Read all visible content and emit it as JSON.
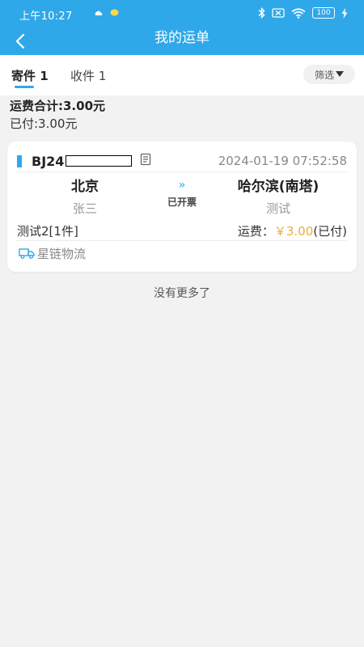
{
  "status_bar": {
    "time": "上午10:27",
    "battery": "100",
    "icons": [
      "weather-icon",
      "chat-icon",
      "bluetooth-icon",
      "sim-off-icon",
      "wifi-icon",
      "battery-icon",
      "charging-icon"
    ]
  },
  "header": {
    "title": "我的运单",
    "back_icon": "chevron-left-icon"
  },
  "tabs": {
    "send_label": "寄件 1",
    "receive_label": "收件 1",
    "filter_label": "筛选",
    "active": "send"
  },
  "summary": {
    "total": "运费合计:3.00元",
    "paid": "已付:3.00元"
  },
  "orders": [
    {
      "number_prefix": "BJ24",
      "date": "2024-01-19 07:52:58",
      "from_city": "北京",
      "from_name": "张三",
      "to_city": "哈尔滨(南塔)",
      "to_name": "测试",
      "route_arrow": "»",
      "invoice_status": "已开票",
      "item": "测试2[1件]",
      "freight_label": "运费：",
      "freight_value": "￥3.00",
      "freight_status": "(已付)",
      "carrier": "星链物流"
    }
  ],
  "footer": {
    "no_more": "没有更多了"
  },
  "colors": {
    "accent": "#2fa8ea",
    "price": "#e4b13a",
    "background": "#f2f2f2"
  }
}
